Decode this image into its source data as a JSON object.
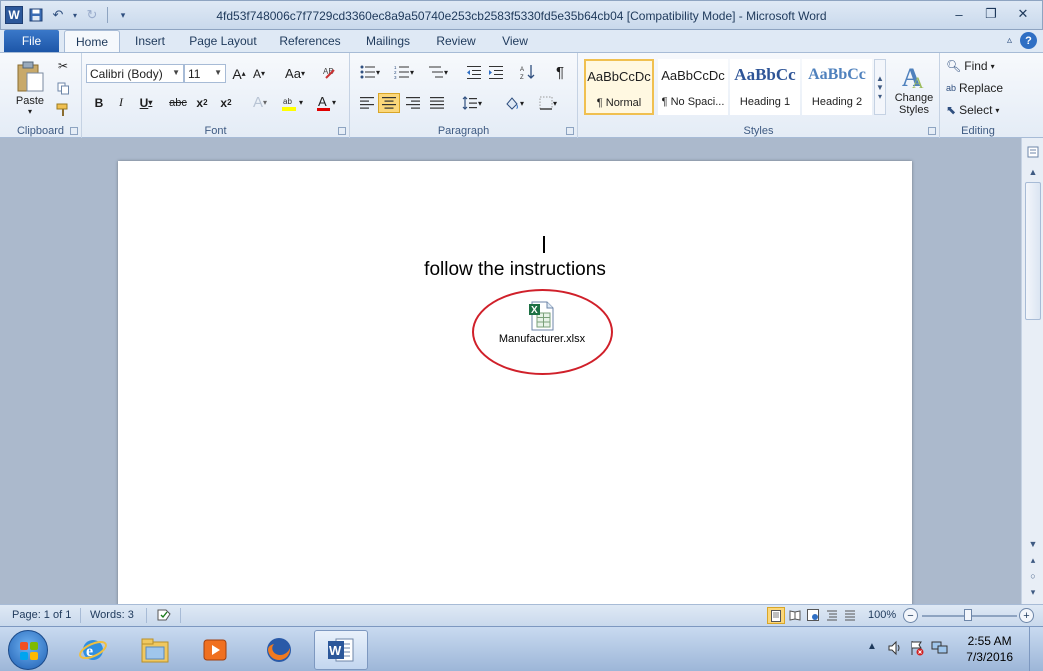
{
  "window": {
    "title": "4fd53f748006c7f7729cd3360ec8a9a50740e253cb2583f5330fd5e35b64cb04 [Compatibility Mode]  -  Microsoft Word",
    "logo_letter": "W"
  },
  "tabs": {
    "file": "File",
    "items": [
      "Home",
      "Insert",
      "Page Layout",
      "References",
      "Mailings",
      "Review",
      "View"
    ],
    "active": "Home",
    "help_symbol": "?"
  },
  "ribbon": {
    "clipboard": {
      "label": "Clipboard",
      "paste": "Paste"
    },
    "font": {
      "label": "Font",
      "font_name": "Calibri (Body)",
      "font_size": "11"
    },
    "paragraph": {
      "label": "Paragraph"
    },
    "styles": {
      "label": "Styles",
      "items": [
        {
          "sample": "AaBbCcDc",
          "name": "¶ Normal"
        },
        {
          "sample": "AaBbCcDc",
          "name": "¶ No Spaci..."
        },
        {
          "sample": "AaBbCc",
          "name": "Heading 1"
        },
        {
          "sample": "AaBbCc",
          "name": "Heading 2"
        }
      ],
      "change_styles_line1": "Change",
      "change_styles_line2": "Styles"
    },
    "editing": {
      "label": "Editing",
      "find": "Find",
      "replace": "Replace",
      "select": "Select"
    }
  },
  "document": {
    "body_text": "follow the instructions",
    "attachment_name": "Manufacturer.xlsx"
  },
  "statusbar": {
    "page": "Page: 1 of 1",
    "words": "Words: 3",
    "zoom": "100%",
    "zoom_level_percent": 100
  },
  "taskbar": {
    "time": "2:55 AM",
    "date": "7/3/2016"
  },
  "colors": {
    "accent": "#2b579a",
    "annotation_circle": "#d0202a",
    "file_tab": "#1d56a8"
  }
}
